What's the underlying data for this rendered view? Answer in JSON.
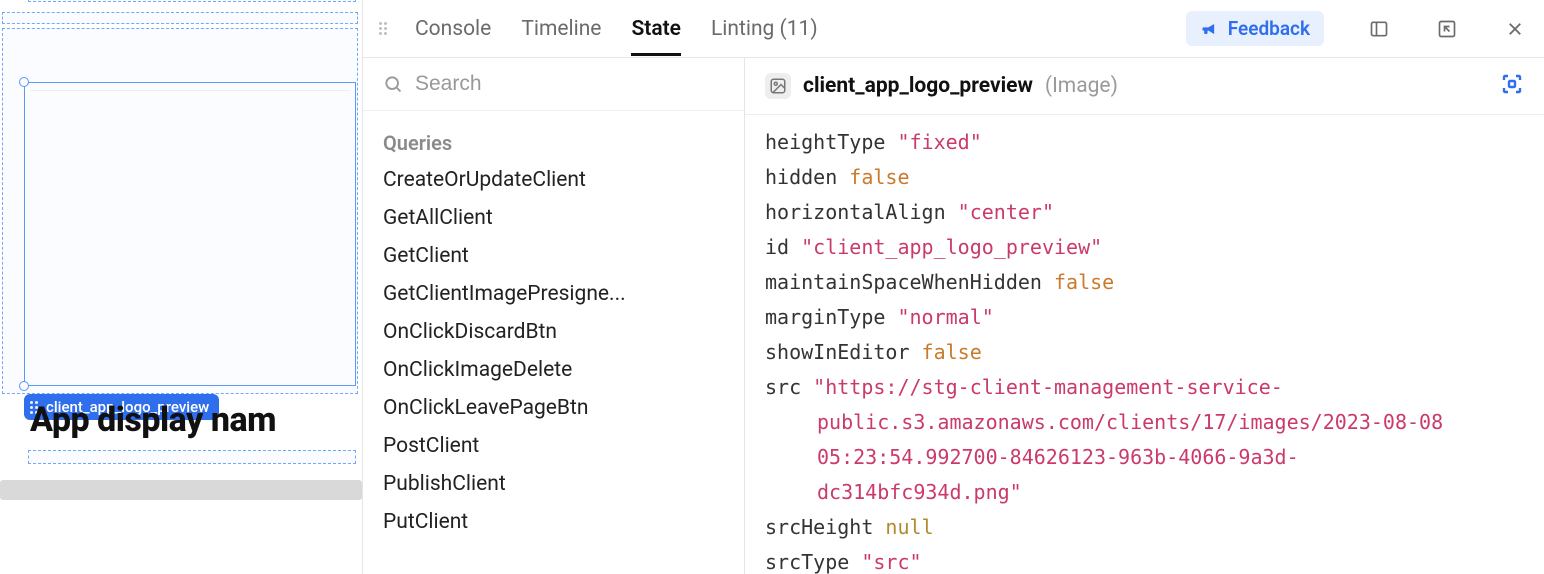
{
  "canvas": {
    "selection_label": "client_app_logo_preview",
    "heading_text": "App display nam"
  },
  "tabs": {
    "console": "Console",
    "timeline": "Timeline",
    "state": "State",
    "linting": "Linting (11)"
  },
  "feedback_label": "Feedback",
  "search": {
    "placeholder": "Search"
  },
  "sidebar": {
    "section_label": "Queries",
    "items": [
      "CreateOrUpdateClient",
      "GetAllClient",
      "GetClient",
      "GetClientImagePresigne...",
      "OnClickDiscardBtn",
      "OnClickImageDelete",
      "OnClickLeavePageBtn",
      "PostClient",
      "PublishClient",
      "PutClient"
    ]
  },
  "detail": {
    "title": "client_app_logo_preview",
    "type": "(Image)"
  },
  "props": {
    "heightType": {
      "k": "heightType",
      "v": "\"fixed\"",
      "cls": "prop-str"
    },
    "hidden": {
      "k": "hidden",
      "v": "false",
      "cls": "prop-bool"
    },
    "horizontalAlign": {
      "k": "horizontalAlign",
      "v": "\"center\"",
      "cls": "prop-str"
    },
    "id": {
      "k": "id",
      "v": "\"client_app_logo_preview\"",
      "cls": "prop-str"
    },
    "maintainSpaceWhenHidden": {
      "k": "maintainSpaceWhenHidden",
      "v": "false",
      "cls": "prop-bool"
    },
    "marginType": {
      "k": "marginType",
      "v": "\"normal\"",
      "cls": "prop-str"
    },
    "showInEditor": {
      "k": "showInEditor",
      "v": "false",
      "cls": "prop-bool"
    },
    "src": {
      "k": "src",
      "l1": "\"https://stg-client-management-service-",
      "l2": "public.s3.amazonaws.com/clients/17/images/2023-08-08",
      "l3": "05:23:54.992700-84626123-963b-4066-9a3d-",
      "l4": "dc314bfc934d.png\""
    },
    "srcHeight": {
      "k": "srcHeight",
      "v": "null",
      "cls": "prop-null"
    },
    "srcType": {
      "k": "srcType",
      "v": "\"src\"",
      "cls": "prop-str"
    }
  }
}
